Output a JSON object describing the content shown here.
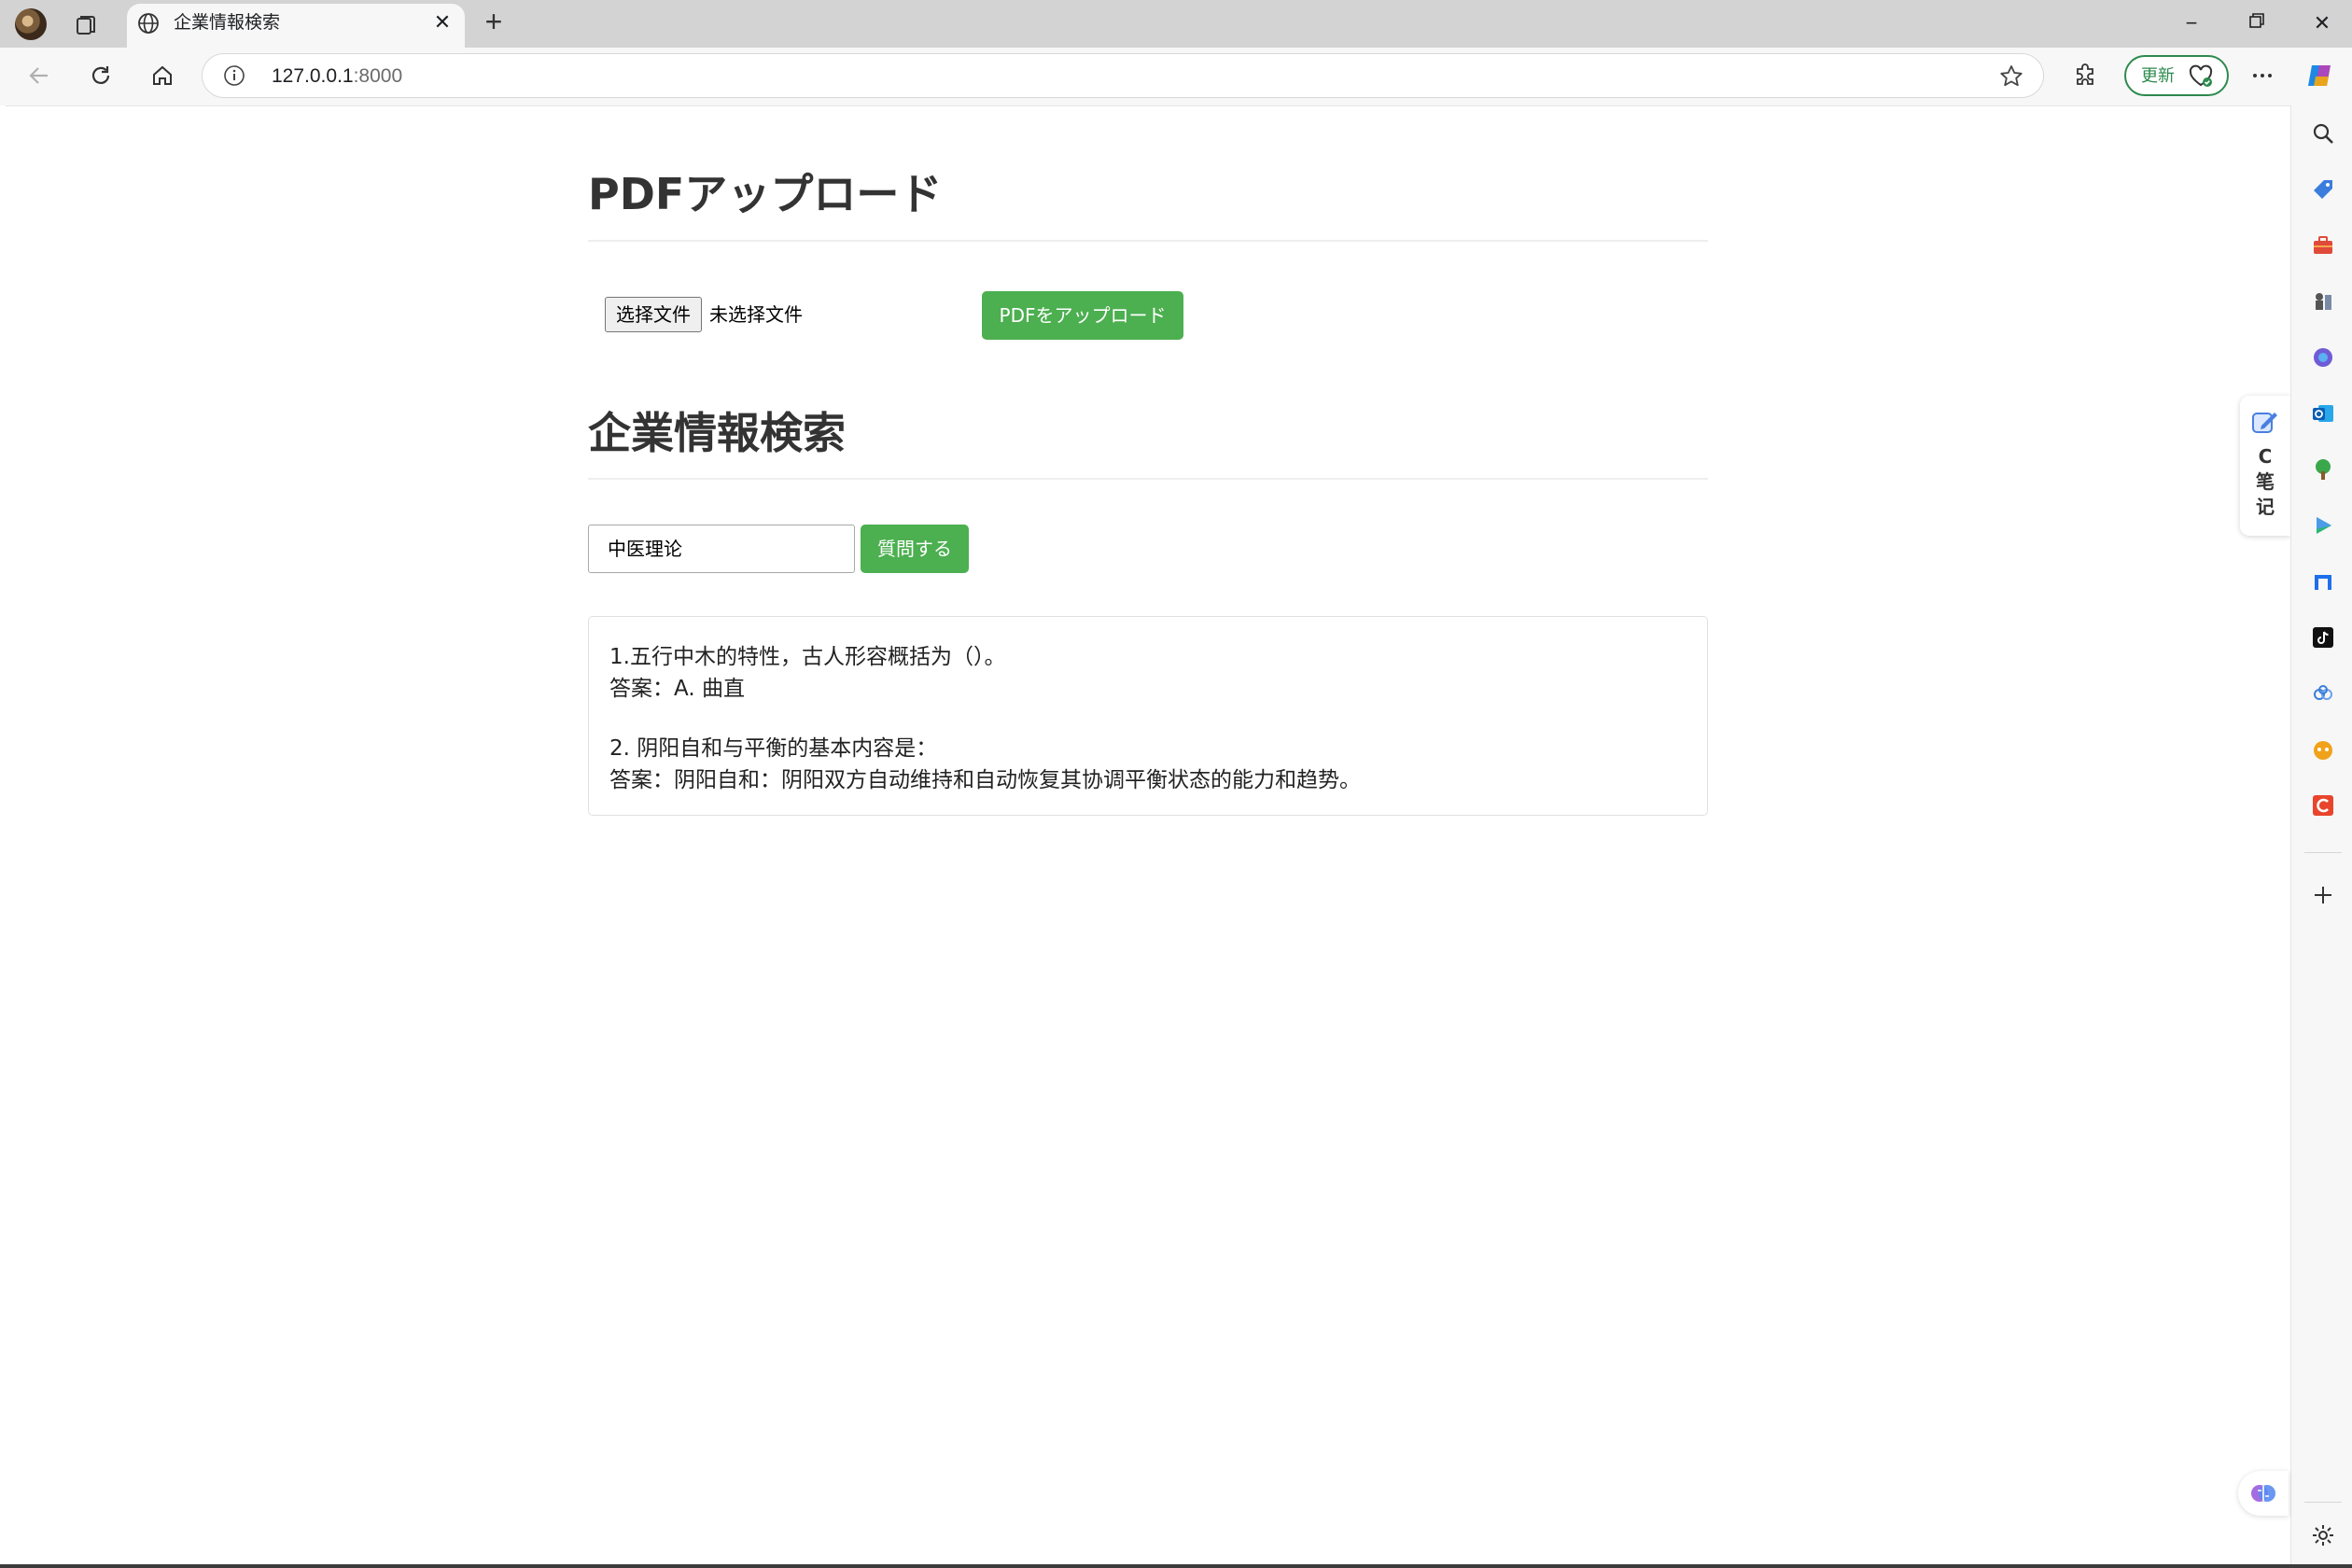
{
  "browser": {
    "tab_title": "企業情報検索",
    "url_host": "127.0.0.1",
    "url_port": ":8000",
    "update_label": "更新"
  },
  "page": {
    "upload_heading": "PDFアップロード",
    "file_button_label": "选择文件",
    "file_status": "未选择文件",
    "upload_button_label": "PDFをアップロード",
    "search_heading": "企業情報検索",
    "query_value": "中医理论",
    "ask_button_label": "質問する",
    "results": [
      {
        "question": "1.五行中木的特性，古人形容概括为（）。",
        "answer": "答案：A. 曲直"
      },
      {
        "question": "2. 阴阳自和与平衡的基本内容是：",
        "answer": "答案：阴阳自和：阴阳双方自动维持和自动恢复其协调平衡状态的能力和趋势。"
      }
    ]
  },
  "sidebar": {
    "note_letter": "C",
    "note_label_1": "笔",
    "note_label_2": "记",
    "icons": [
      "search-icon",
      "tag-icon",
      "briefcase-icon",
      "chess-icon",
      "copilot-app-icon",
      "outlook-icon",
      "tree-icon",
      "play-icon",
      "app-icon",
      "tiktok-icon",
      "link-icon",
      "game-icon",
      "c-app-icon"
    ]
  },
  "colors": {
    "accent_green": "#4caf50",
    "update_green": "#2d8a4e",
    "heading": "#333333"
  }
}
